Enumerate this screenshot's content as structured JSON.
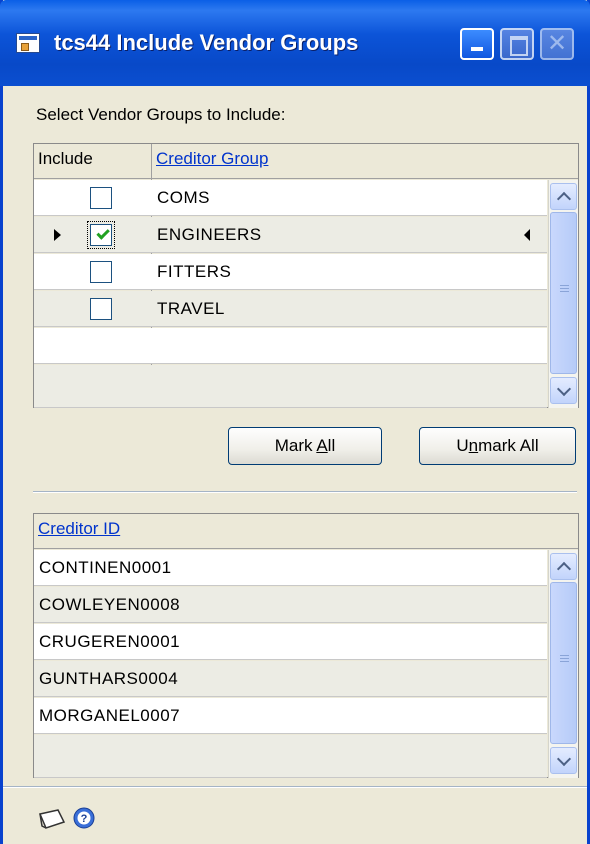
{
  "window": {
    "title": "tcs44 Include Vendor Groups"
  },
  "prompt": "Select Vendor Groups to Include:",
  "groups_grid": {
    "col_include": "Include",
    "col_group": "Creditor Group",
    "rows": [
      {
        "name": "COMS",
        "checked": false
      },
      {
        "name": "ENGINEERS",
        "checked": true
      },
      {
        "name": "FITTERS",
        "checked": false
      },
      {
        "name": "TRAVEL",
        "checked": false
      },
      {
        "name": ""
      },
      {
        "name": ""
      }
    ]
  },
  "buttons": {
    "mark_all": "Mark All",
    "unmark_all": "Unmark All"
  },
  "creditor_grid": {
    "col_id": "Creditor ID",
    "rows": [
      "CONTINEN0001",
      "COWLEYEN0008",
      "CRUGEREN0001",
      "GUNTHARS0004",
      "MORGANEL0007",
      ""
    ]
  },
  "footer": {
    "icons": [
      "note-icon",
      "help-icon"
    ]
  },
  "colors": {
    "titlebar": "#0842ce",
    "link": "#0033cc",
    "checkmark": "#21a121"
  }
}
